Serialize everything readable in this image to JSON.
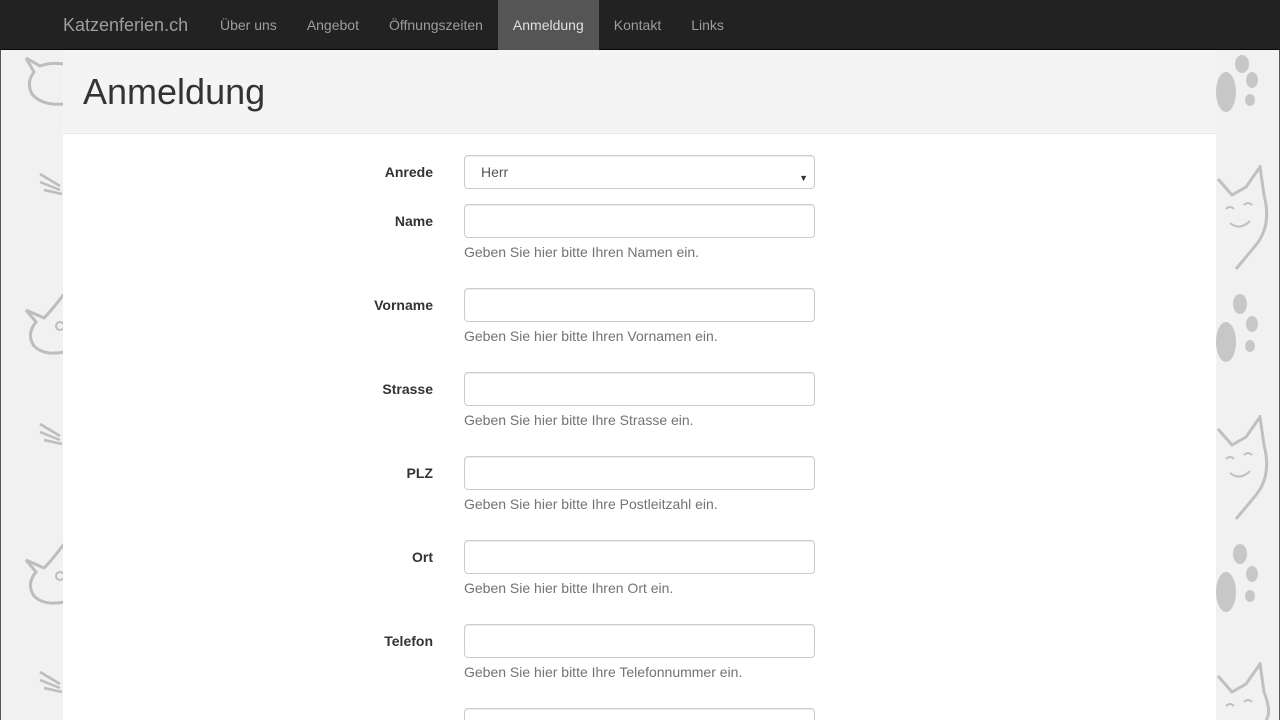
{
  "navbar": {
    "brand": "Katzenferien.ch",
    "items": [
      {
        "label": "Über uns",
        "active": false
      },
      {
        "label": "Angebot",
        "active": false
      },
      {
        "label": "Öffnungszeiten",
        "active": false
      },
      {
        "label": "Anmeldung",
        "active": true
      },
      {
        "label": "Kontakt",
        "active": false
      },
      {
        "label": "Links",
        "active": false
      }
    ]
  },
  "page": {
    "title": "Anmeldung"
  },
  "form": {
    "anrede": {
      "label": "Anrede",
      "value": "Herr"
    },
    "fields": [
      {
        "label": "Name",
        "value": "",
        "help": "Geben Sie hier bitte Ihren Namen ein."
      },
      {
        "label": "Vorname",
        "value": "",
        "help": "Geben Sie hier bitte Ihren Vornamen ein."
      },
      {
        "label": "Strasse",
        "value": "",
        "help": "Geben Sie hier bitte Ihre Strasse ein."
      },
      {
        "label": "PLZ",
        "value": "",
        "help": "Geben Sie hier bitte Ihre Postleitzahl ein."
      },
      {
        "label": "Ort",
        "value": "",
        "help": "Geben Sie hier bitte Ihren Ort ein."
      },
      {
        "label": "Telefon",
        "value": "",
        "help": "Geben Sie hier bitte Ihre Telefonnummer ein."
      }
    ]
  },
  "colors": {
    "navbar_bg": "#222222",
    "nav_active_bg": "#555555",
    "nav_text": "#9d9d9d",
    "help_text": "#737373"
  }
}
